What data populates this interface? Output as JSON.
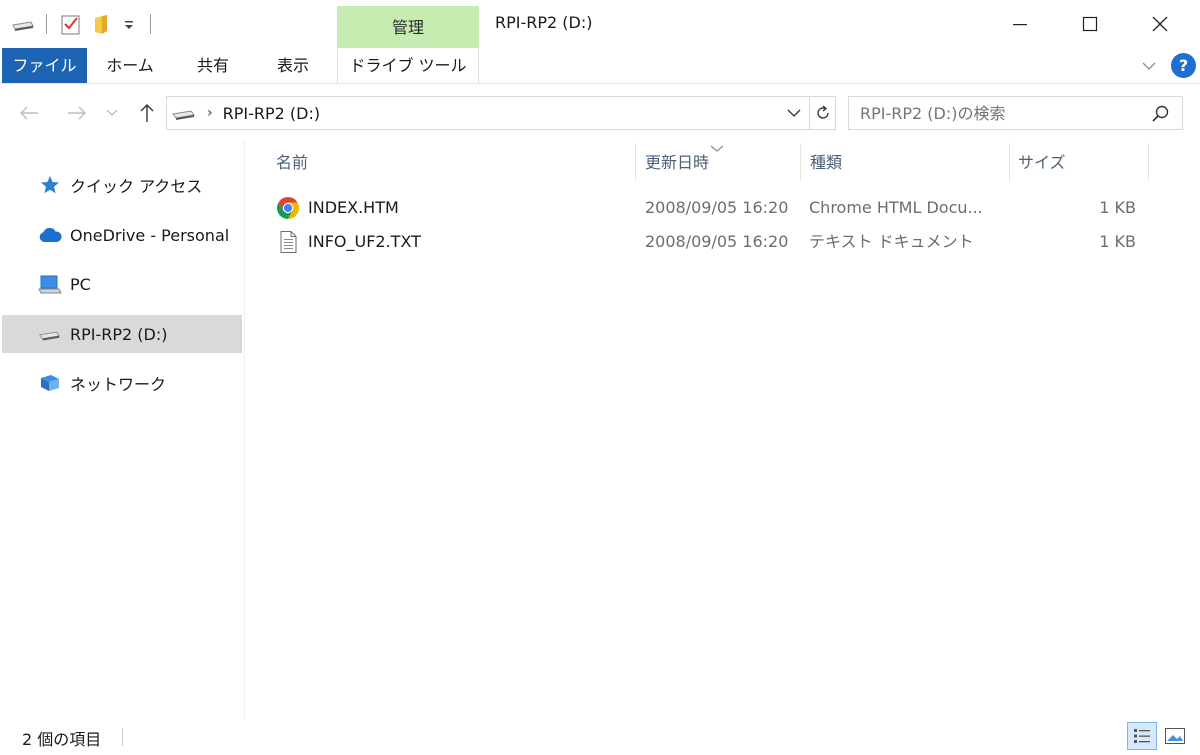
{
  "window": {
    "title": "RPI-RP2 (D:)",
    "context_tab_group": "管理"
  },
  "ribbon": {
    "tabs": [
      {
        "label": "ファイル",
        "active": true
      },
      {
        "label": "ホーム"
      },
      {
        "label": "共有"
      },
      {
        "label": "表示"
      },
      {
        "label": "ドライブ ツール"
      }
    ],
    "help": "?"
  },
  "address": {
    "path_segment": "RPI-RP2 (D:)",
    "search_placeholder": "RPI-RP2 (D:)の検索"
  },
  "sidebar": {
    "items": [
      {
        "label": "クイック アクセス",
        "icon": "star-icon"
      },
      {
        "label": "OneDrive - Personal",
        "icon": "cloud-icon"
      },
      {
        "label": "PC",
        "icon": "computer-icon"
      },
      {
        "label": "RPI-RP2 (D:)",
        "icon": "drive-icon",
        "selected": true
      },
      {
        "label": "ネットワーク",
        "icon": "network-icon"
      }
    ]
  },
  "filelist": {
    "columns": {
      "name": "名前",
      "date": "更新日時",
      "type": "種類",
      "size": "サイズ"
    },
    "sorted_by": "更新日時",
    "rows": [
      {
        "name": "INDEX.HTM",
        "date": "2008/09/05 16:20",
        "type": "Chrome HTML Docu...",
        "size": "1 KB",
        "icon": "chrome-icon"
      },
      {
        "name": "INFO_UF2.TXT",
        "date": "2008/09/05 16:20",
        "type": "テキスト ドキュメント",
        "size": "1 KB",
        "icon": "text-file-icon"
      }
    ]
  },
  "status": {
    "item_count": "2 個の項目"
  },
  "colors": {
    "file_tab": "#1e64b4",
    "context_tab": "#c7ecb1",
    "selection": "#d9d9d9"
  }
}
